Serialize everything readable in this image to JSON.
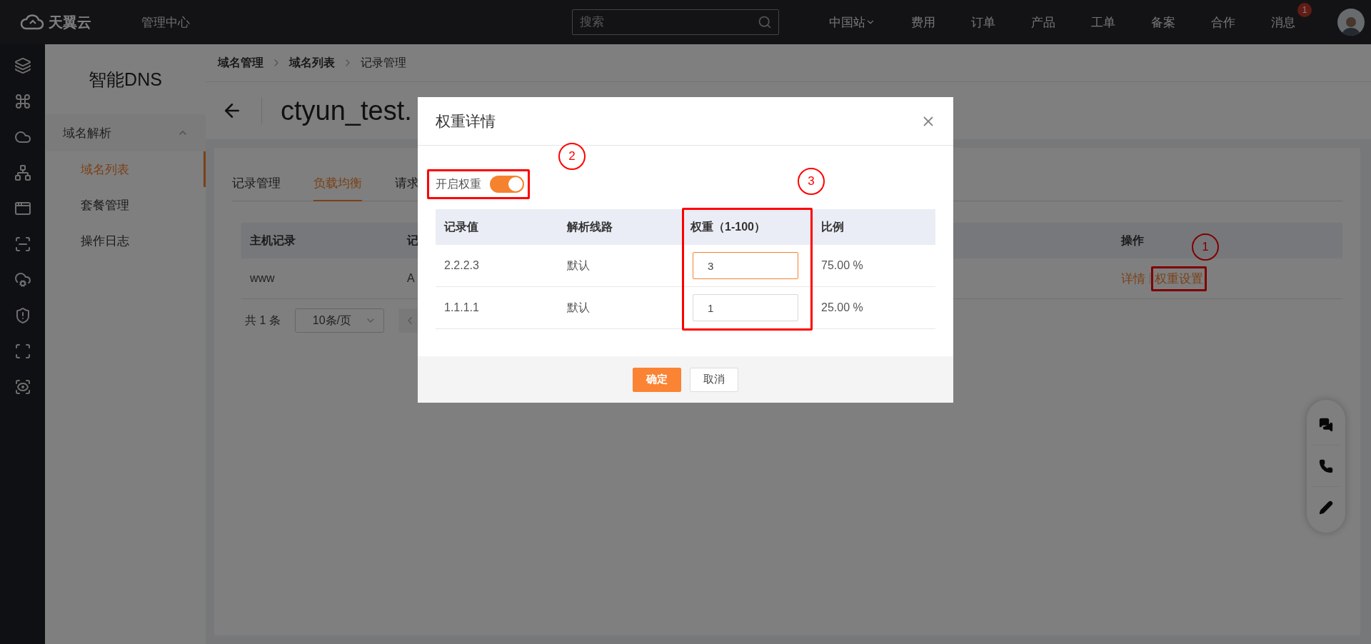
{
  "top_bar": {
    "logo": "天翼云",
    "title": "管理中心",
    "search": {
      "placeholder": "搜索"
    },
    "nav": [
      {
        "label": "中国站",
        "kind": "dropdown"
      },
      {
        "label": "费用",
        "kind": "link"
      },
      {
        "label": "订单",
        "kind": "link"
      },
      {
        "label": "产品",
        "kind": "link"
      },
      {
        "label": "工单",
        "kind": "link"
      },
      {
        "label": "备案",
        "kind": "link"
      },
      {
        "label": "合作",
        "kind": "link"
      },
      {
        "label": "消息",
        "kind": "badge",
        "badge": "1"
      }
    ]
  },
  "sidebar": {
    "title": "智能DNS",
    "groups": [
      {
        "label": "域名解析",
        "expanded": true,
        "children": [
          {
            "label": "域名列表",
            "selected": true
          },
          {
            "label": "套餐管理",
            "selected": false
          },
          {
            "label": "操作日志",
            "selected": false
          }
        ]
      }
    ]
  },
  "breadcrumb": [
    {
      "label": "域名管理",
      "selected": false
    },
    {
      "label": "域名列表",
      "selected": false
    },
    {
      "label": "记录管理",
      "selected": true
    }
  ],
  "page_title": "ctyun_test.",
  "tabs": [
    {
      "label": "记录管理",
      "selected": false
    },
    {
      "label": "负载均衡",
      "selected": true
    },
    {
      "label": "请求",
      "selected": false
    }
  ],
  "table": {
    "columns": [
      "主机记录",
      "记",
      "操作"
    ],
    "rows": [
      {
        "cells": [
          "www",
          "A"
        ],
        "actions": [
          "详情",
          "权重设置"
        ]
      }
    ]
  },
  "pagination": {
    "total": "共 1 条",
    "page_size": "10条/页"
  },
  "dialog": {
    "title": "权重详情",
    "toggle": {
      "label": "开启权重",
      "on": true
    },
    "columns": [
      "记录值",
      "解析线路",
      "权重（1-100）",
      "比例"
    ],
    "rows": [
      {
        "value": "2.2.2.3",
        "line": "默认",
        "weight": "3",
        "focused": true,
        "ratio": "75.00 %"
      },
      {
        "value": "1.1.1.1",
        "line": "默认",
        "weight": "1",
        "focused": false,
        "ratio": "25.00 %"
      }
    ],
    "buttons": [
      {
        "label": "确定",
        "kind": "primary"
      },
      {
        "label": "取消",
        "kind": "default"
      }
    ]
  },
  "annotations": [
    {
      "label": "1"
    },
    {
      "label": "2"
    },
    {
      "label": "3"
    }
  ]
}
